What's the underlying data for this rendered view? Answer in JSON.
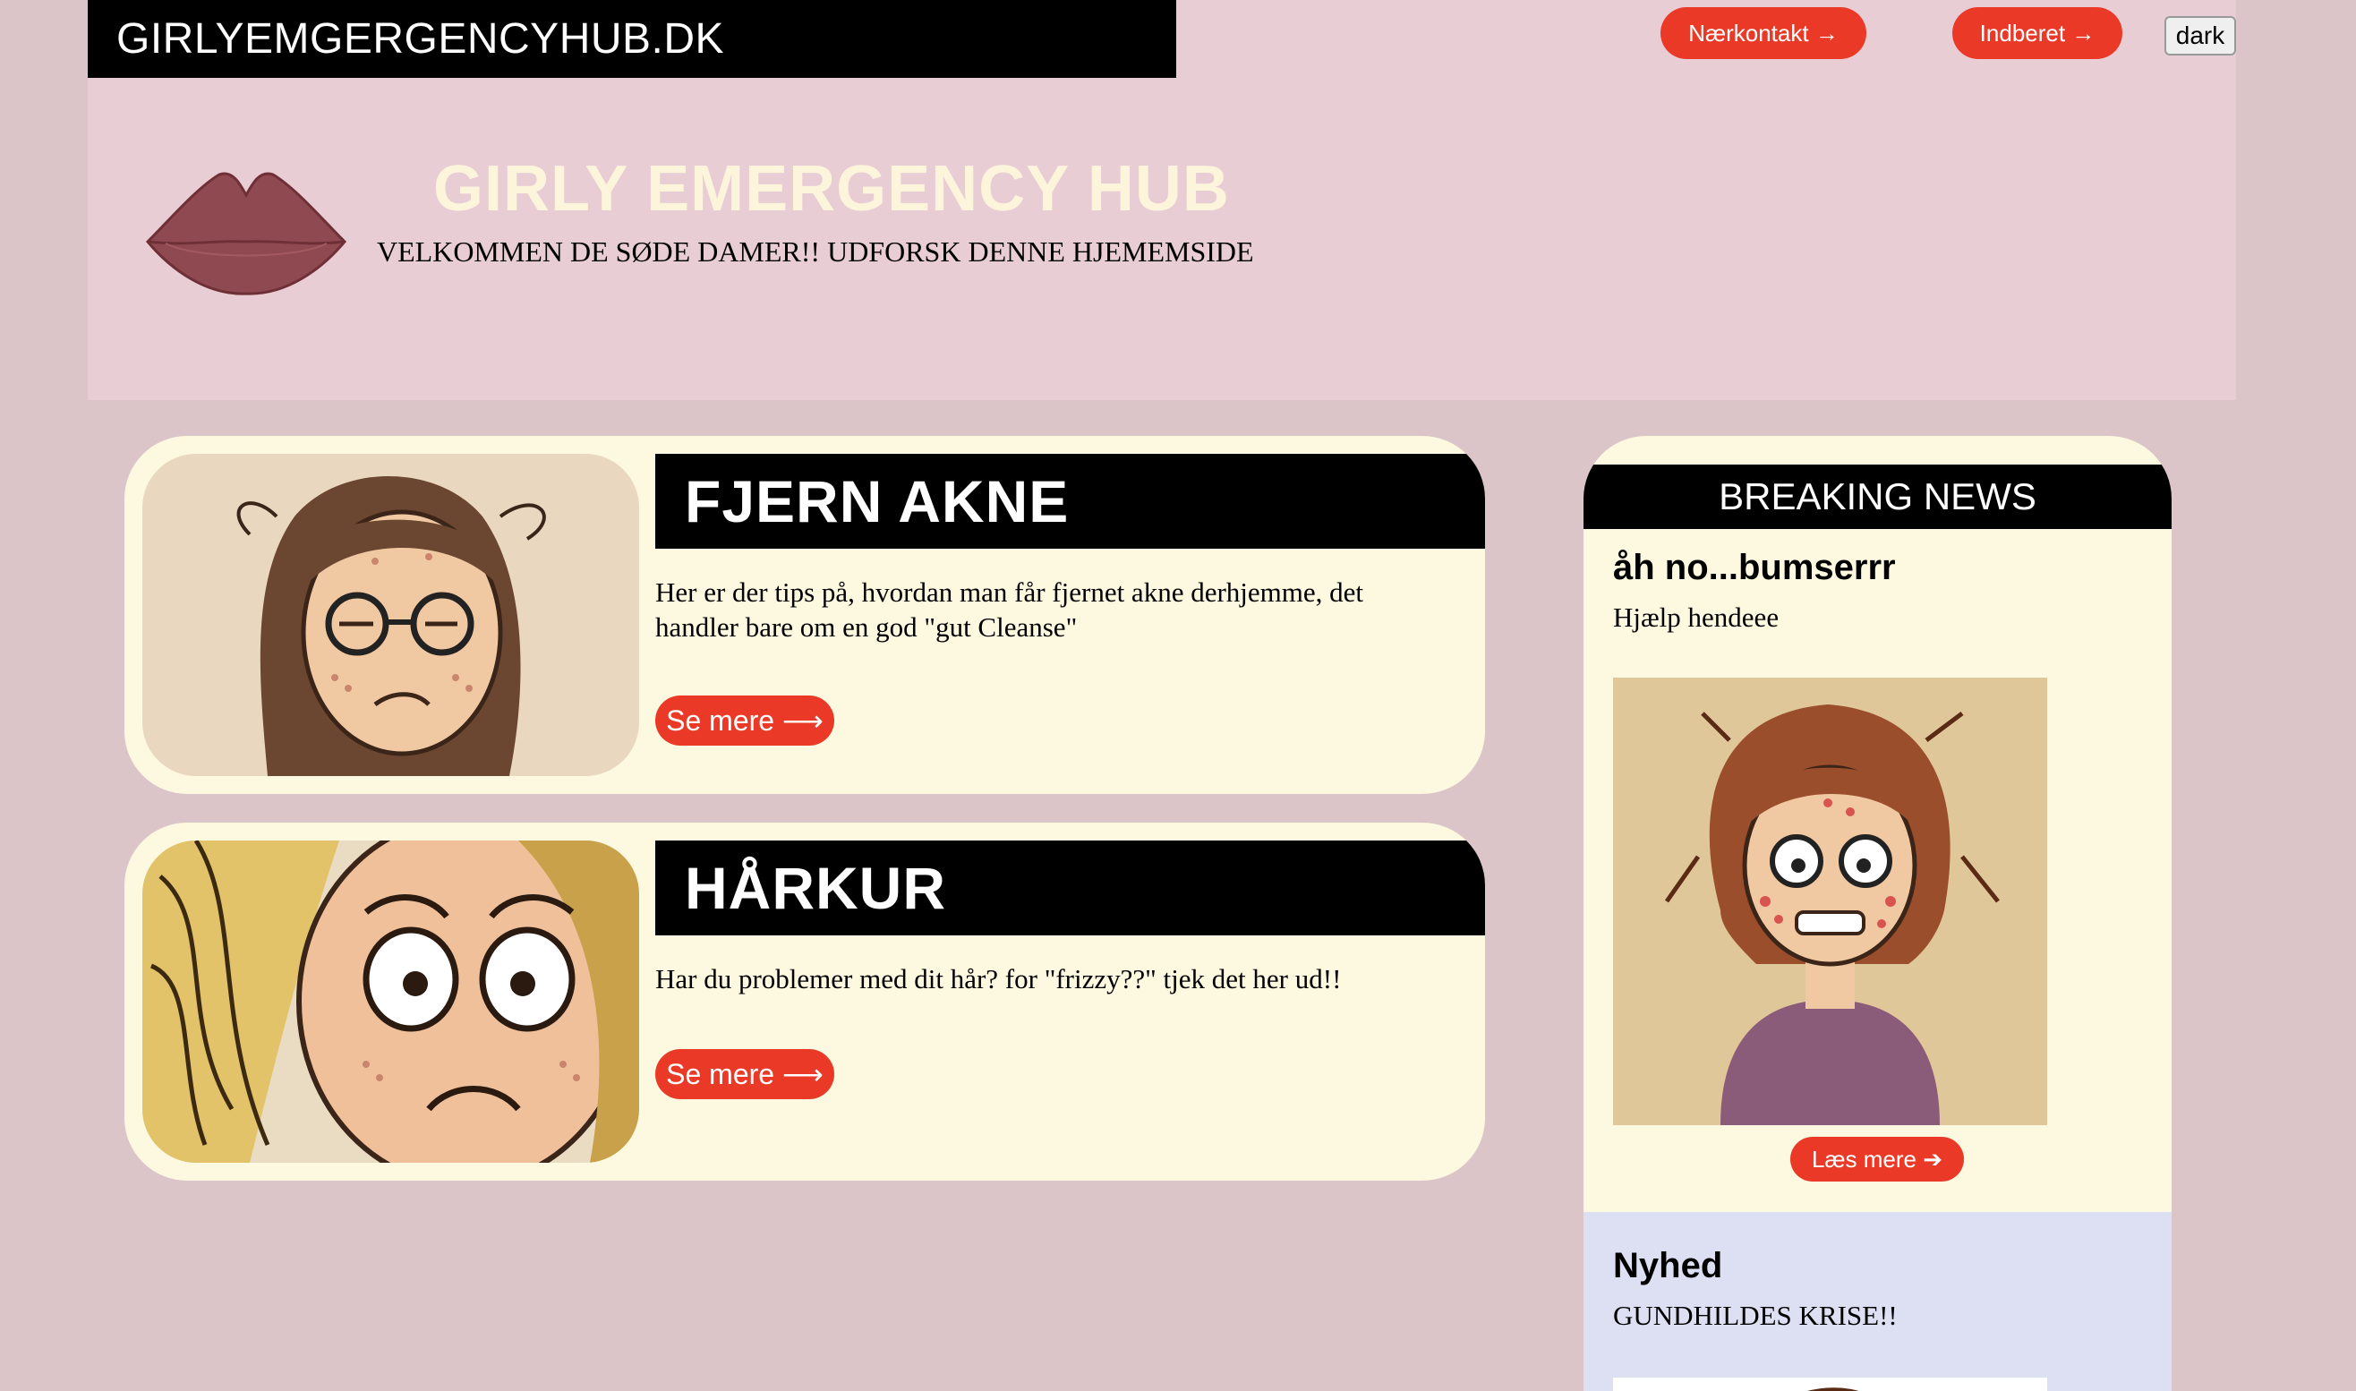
{
  "header": {
    "brand": "GIRLYEMGERGENCYHUB.DK",
    "nav": {
      "contact_label": "Nærkontakt →",
      "report_label": "Indberet →",
      "theme_label": "dark"
    },
    "title": "GIRLY EMERGENCY HUB",
    "subtitle": "VELKOMMEN DE SØDE DAMER!! UDFORSK DENNE HJEMEMSIDE",
    "logo_icon": "lips-icon"
  },
  "cards": [
    {
      "title": "FJERN AKNE",
      "text": "Her er der tips på, hvordan man får fjernet akne derhjemme, det handler bare om en god \"gut Cleanse\"",
      "button": "Se mere ⟶"
    },
    {
      "title": "HÅRKUR",
      "text": "Har du problemer med dit hår? for \"frizzy??\" tjek det her ud!!",
      "button": "Se mere ⟶"
    }
  ],
  "sidebar": {
    "heading": "BREAKING NEWS",
    "news": {
      "title": "åh no...bumserrr",
      "subtitle": "Hjælp hendeee",
      "button": "Læs mere ➔"
    },
    "nyhed": {
      "title": "Nyhed",
      "subtitle": "GUNDHILDES KRISE!!"
    }
  },
  "colors": {
    "page_bg": "#dbc5c8",
    "header_bg": "#e8cdd5",
    "card_bg": "#fdf8e0",
    "accent": "#ea3a27",
    "nyhed_bg": "#dde0f3"
  }
}
